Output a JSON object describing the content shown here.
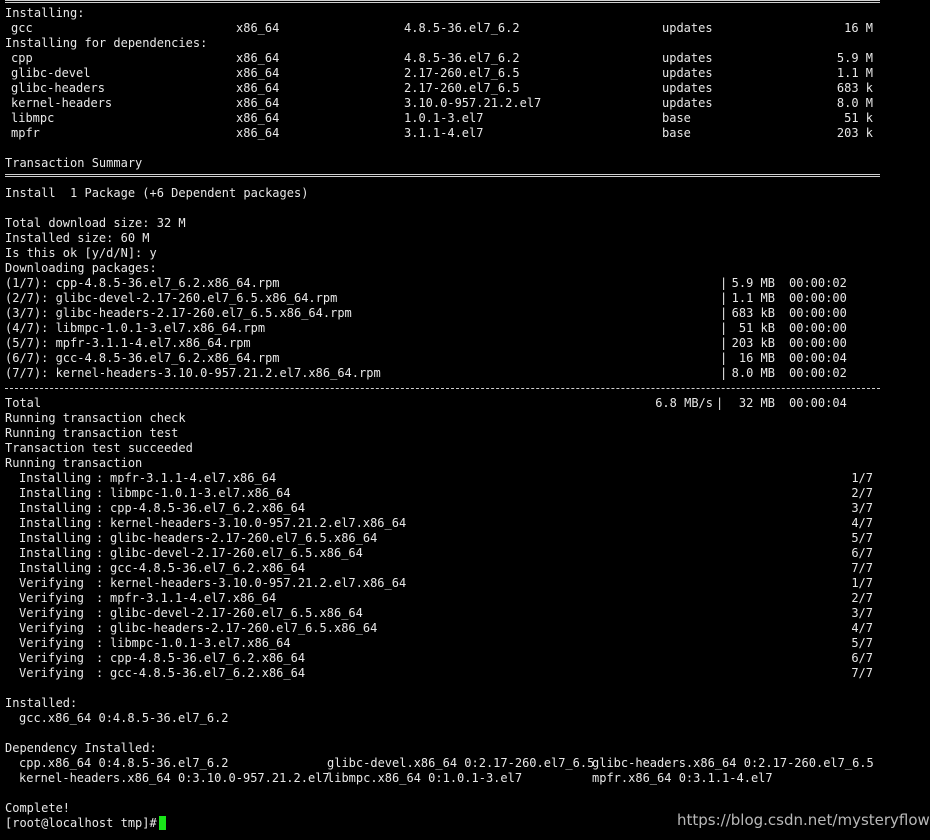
{
  "header": {
    "installing": "Installing:",
    "main_pkg": {
      "name": "gcc",
      "arch": "x86_64",
      "version": "4.8.5-36.el7_6.2",
      "repo": "updates",
      "size": "16 M"
    },
    "deps_heading": "Installing for dependencies:",
    "deps": [
      {
        "name": "cpp",
        "arch": "x86_64",
        "version": "4.8.5-36.el7_6.2",
        "repo": "updates",
        "size": "5.9 M"
      },
      {
        "name": "glibc-devel",
        "arch": "x86_64",
        "version": "2.17-260.el7_6.5",
        "repo": "updates",
        "size": "1.1 M"
      },
      {
        "name": "glibc-headers",
        "arch": "x86_64",
        "version": "2.17-260.el7_6.5",
        "repo": "updates",
        "size": "683 k"
      },
      {
        "name": "kernel-headers",
        "arch": "x86_64",
        "version": "3.10.0-957.21.2.el7",
        "repo": "updates",
        "size": "8.0 M"
      },
      {
        "name": "libmpc",
        "arch": "x86_64",
        "version": "1.0.1-3.el7",
        "repo": "base",
        "size": "51 k"
      },
      {
        "name": "mpfr",
        "arch": "x86_64",
        "version": "3.1.1-4.el7",
        "repo": "base",
        "size": "203 k"
      }
    ]
  },
  "summary": {
    "title": "Transaction Summary",
    "install_line": "Install  1 Package (+6 Dependent packages)",
    "total_download": "Total download size: 32 M",
    "installed_size": "Installed size: 60 M",
    "prompt": "Is this ok [y/d/N]: y",
    "downloading": "Downloading packages:"
  },
  "downloads": [
    {
      "file": "(1/7): cpp-4.8.5-36.el7_6.2.x86_64.rpm",
      "size": "5.9 MB",
      "time": "00:00:02"
    },
    {
      "file": "(2/7): glibc-devel-2.17-260.el7_6.5.x86_64.rpm",
      "size": "1.1 MB",
      "time": "00:00:00"
    },
    {
      "file": "(3/7): glibc-headers-2.17-260.el7_6.5.x86_64.rpm",
      "size": "683 kB",
      "time": "00:00:00"
    },
    {
      "file": "(4/7): libmpc-1.0.1-3.el7.x86_64.rpm",
      "size": "51 kB",
      "time": "00:00:00"
    },
    {
      "file": "(5/7): mpfr-3.1.1-4.el7.x86_64.rpm",
      "size": "203 kB",
      "time": "00:00:00"
    },
    {
      "file": "(6/7): gcc-4.8.5-36.el7_6.2.x86_64.rpm",
      "size": "16 MB",
      "time": "00:00:04"
    },
    {
      "file": "(7/7): kernel-headers-3.10.0-957.21.2.el7.x86_64.rpm",
      "size": "8.0 MB",
      "time": "00:00:02"
    }
  ],
  "total": {
    "label": "Total",
    "rate": "6.8 MB/s",
    "size": "32 MB",
    "time": "00:00:04"
  },
  "transaction_status": [
    "Running transaction check",
    "Running transaction test",
    "Transaction test succeeded",
    "Running transaction"
  ],
  "steps": [
    {
      "action": "Installing",
      "pkg": "mpfr-3.1.1-4.el7.x86_64",
      "count": "1/7"
    },
    {
      "action": "Installing",
      "pkg": "libmpc-1.0.1-3.el7.x86_64",
      "count": "2/7"
    },
    {
      "action": "Installing",
      "pkg": "cpp-4.8.5-36.el7_6.2.x86_64",
      "count": "3/7"
    },
    {
      "action": "Installing",
      "pkg": "kernel-headers-3.10.0-957.21.2.el7.x86_64",
      "count": "4/7"
    },
    {
      "action": "Installing",
      "pkg": "glibc-headers-2.17-260.el7_6.5.x86_64",
      "count": "5/7"
    },
    {
      "action": "Installing",
      "pkg": "glibc-devel-2.17-260.el7_6.5.x86_64",
      "count": "6/7"
    },
    {
      "action": "Installing",
      "pkg": "gcc-4.8.5-36.el7_6.2.x86_64",
      "count": "7/7"
    },
    {
      "action": "Verifying",
      "pkg": "kernel-headers-3.10.0-957.21.2.el7.x86_64",
      "count": "1/7"
    },
    {
      "action": "Verifying",
      "pkg": "mpfr-3.1.1-4.el7.x86_64",
      "count": "2/7"
    },
    {
      "action": "Verifying",
      "pkg": "glibc-devel-2.17-260.el7_6.5.x86_64",
      "count": "3/7"
    },
    {
      "action": "Verifying",
      "pkg": "glibc-headers-2.17-260.el7_6.5.x86_64",
      "count": "4/7"
    },
    {
      "action": "Verifying",
      "pkg": "libmpc-1.0.1-3.el7.x86_64",
      "count": "5/7"
    },
    {
      "action": "Verifying",
      "pkg": "cpp-4.8.5-36.el7_6.2.x86_64",
      "count": "6/7"
    },
    {
      "action": "Verifying",
      "pkg": "gcc-4.8.5-36.el7_6.2.x86_64",
      "count": "7/7"
    }
  ],
  "installed": {
    "heading": "Installed:",
    "item": "gcc.x86_64 0:4.8.5-36.el7_6.2"
  },
  "dependency_installed": {
    "heading": "Dependency Installed:",
    "items": [
      "cpp.x86_64 0:4.8.5-36.el7_6.2",
      "glibc-devel.x86_64 0:2.17-260.el7_6.5",
      "glibc-headers.x86_64 0:2.17-260.el7_6.5",
      "kernel-headers.x86_64 0:3.10.0-957.21.2.el7",
      "libmpc.x86_64 0:1.0.1-3.el7",
      "mpfr.x86_64 0:3.1.1-4.el7"
    ]
  },
  "complete": "Complete!",
  "prompt_line": "[root@localhost tmp]#",
  "watermark": "https://blog.csdn.net/mysteryflower",
  "colors": {
    "background": "#000000",
    "text": "#e8e8e8",
    "cursor": "#19e619"
  }
}
